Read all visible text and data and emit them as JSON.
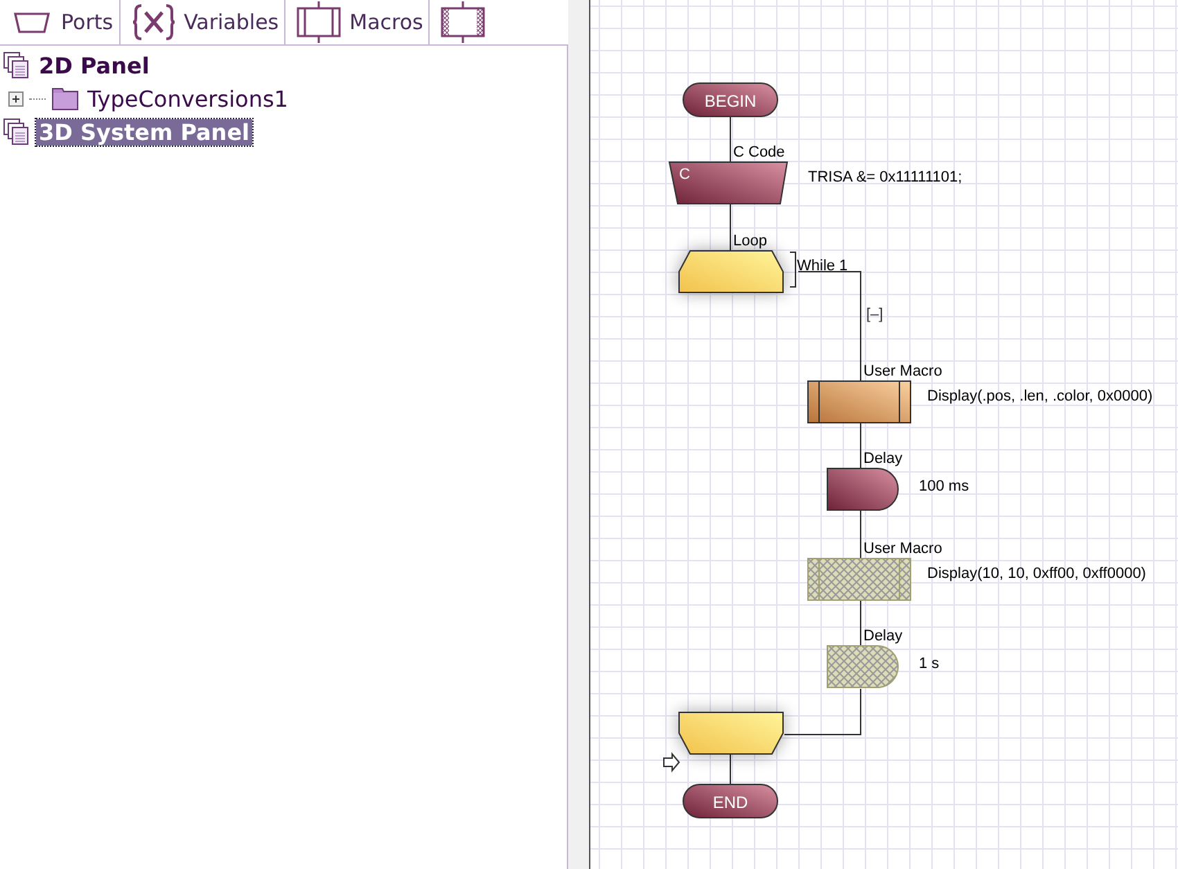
{
  "tabs": [
    {
      "label": "Ports",
      "kind": "ports"
    },
    {
      "label": "Variables",
      "kind": "variables"
    },
    {
      "label": "Macros",
      "kind": "macros"
    },
    {
      "kind": "macros_hatched"
    }
  ],
  "tree": [
    {
      "label": "2D Panel",
      "kind": "panel",
      "selected": false,
      "children": [
        {
          "label": "TypeConversions1",
          "kind": "folder",
          "selected": false,
          "expanded": false
        }
      ]
    },
    {
      "label": "3D System Panel",
      "kind": "panel",
      "selected": true
    }
  ],
  "flowchart": {
    "nodes": [
      {
        "kind": "terminal",
        "label": "BEGIN",
        "disabled": false
      },
      {
        "kind": "ccode",
        "caption": "C Code",
        "label": "C",
        "detail": "TRISA &= 0x11111101;",
        "disabled": false
      },
      {
        "kind": "loop_start",
        "caption": "Loop",
        "detail": "While 1",
        "collapse": "[–]",
        "disabled": false
      },
      {
        "kind": "macro",
        "caption": "User Macro",
        "detail": "Display(.pos, .len, .color, 0x0000)",
        "disabled": false
      },
      {
        "kind": "delay",
        "caption": "Delay",
        "detail": "100 ms",
        "disabled": false
      },
      {
        "kind": "macro",
        "caption": "User Macro",
        "detail": "Display(10, 10, 0xff00, 0xff0000)",
        "disabled": true
      },
      {
        "kind": "delay",
        "caption": "Delay",
        "detail": "1 s",
        "disabled": true
      },
      {
        "kind": "loop_end",
        "disabled": false
      },
      {
        "kind": "terminal",
        "label": "END",
        "disabled": false
      }
    ]
  }
}
